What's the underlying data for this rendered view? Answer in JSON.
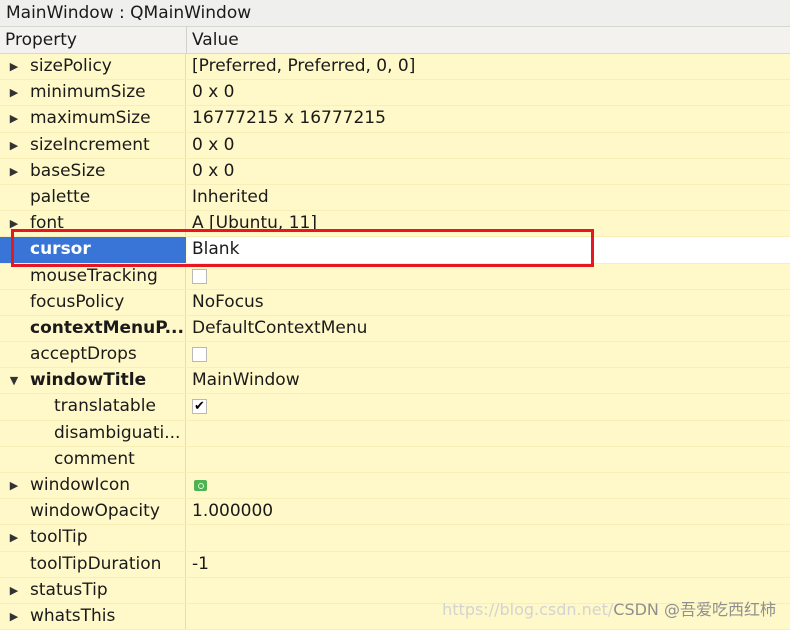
{
  "window": {
    "title": "MainWindow : QMainWindow"
  },
  "header": {
    "property": "Property",
    "value": "Value"
  },
  "rows": [
    {
      "name": "sizePolicy",
      "value": "[Preferred, Preferred, 0, 0]",
      "expander": "collapsed",
      "bold": false,
      "indent": 0,
      "type": "text"
    },
    {
      "name": "minimumSize",
      "value": "0 x 0",
      "expander": "collapsed",
      "bold": false,
      "indent": 0,
      "type": "text"
    },
    {
      "name": "maximumSize",
      "value": "16777215 x 16777215",
      "expander": "collapsed",
      "bold": false,
      "indent": 0,
      "type": "text"
    },
    {
      "name": "sizeIncrement",
      "value": "0 x 0",
      "expander": "collapsed",
      "bold": false,
      "indent": 0,
      "type": "text"
    },
    {
      "name": "baseSize",
      "value": "0 x 0",
      "expander": "collapsed",
      "bold": false,
      "indent": 0,
      "type": "text"
    },
    {
      "name": "palette",
      "value": "Inherited",
      "expander": "none",
      "bold": false,
      "indent": 0,
      "type": "text"
    },
    {
      "name": "font",
      "value": "A  [Ubuntu, 11]",
      "expander": "collapsed",
      "bold": false,
      "indent": 0,
      "type": "text"
    },
    {
      "name": "cursor",
      "value": "Blank",
      "expander": "none",
      "bold": true,
      "indent": 0,
      "type": "text",
      "selected": true
    },
    {
      "name": "mouseTracking",
      "value": "",
      "expander": "none",
      "bold": false,
      "indent": 0,
      "type": "checkbox",
      "checked": false
    },
    {
      "name": "focusPolicy",
      "value": "NoFocus",
      "expander": "none",
      "bold": false,
      "indent": 0,
      "type": "text"
    },
    {
      "name": "contextMenuP...",
      "value": "DefaultContextMenu",
      "expander": "none",
      "bold": true,
      "indent": 0,
      "type": "text"
    },
    {
      "name": "acceptDrops",
      "value": "",
      "expander": "none",
      "bold": false,
      "indent": 0,
      "type": "checkbox",
      "checked": false
    },
    {
      "name": "windowTitle",
      "value": "MainWindow",
      "expander": "expanded",
      "bold": true,
      "indent": 0,
      "type": "text"
    },
    {
      "name": "translatable",
      "value": "",
      "expander": "none",
      "bold": false,
      "indent": 1,
      "type": "checkbox",
      "checked": true
    },
    {
      "name": "disambiguati...",
      "value": "",
      "expander": "none",
      "bold": false,
      "indent": 1,
      "type": "text"
    },
    {
      "name": "comment",
      "value": "",
      "expander": "none",
      "bold": false,
      "indent": 1,
      "type": "text"
    },
    {
      "name": "windowIcon",
      "value": "",
      "expander": "collapsed",
      "bold": false,
      "indent": 0,
      "type": "icon",
      "icon": "qt-icon"
    },
    {
      "name": "windowOpacity",
      "value": "1.000000",
      "expander": "none",
      "bold": false,
      "indent": 0,
      "type": "text"
    },
    {
      "name": "toolTip",
      "value": "",
      "expander": "collapsed",
      "bold": false,
      "indent": 0,
      "type": "text"
    },
    {
      "name": "toolTipDuration",
      "value": "-1",
      "expander": "none",
      "bold": false,
      "indent": 0,
      "type": "text"
    },
    {
      "name": "statusTip",
      "value": "",
      "expander": "collapsed",
      "bold": false,
      "indent": 0,
      "type": "text"
    },
    {
      "name": "whatsThis",
      "value": "",
      "expander": "collapsed",
      "bold": false,
      "indent": 0,
      "type": "text"
    }
  ],
  "icons": {
    "collapsed": "triangle-right-icon",
    "expanded": "triangle-down-icon",
    "checked": "checkmark-icon"
  },
  "watermark": {
    "faint": "https://blog.csdn.net/",
    "main": "CSDN @吾爱吃西红柿"
  },
  "colors": {
    "row_bg": "#fff8c8",
    "selection": "#3875d7",
    "highlight": "#e8161e"
  }
}
